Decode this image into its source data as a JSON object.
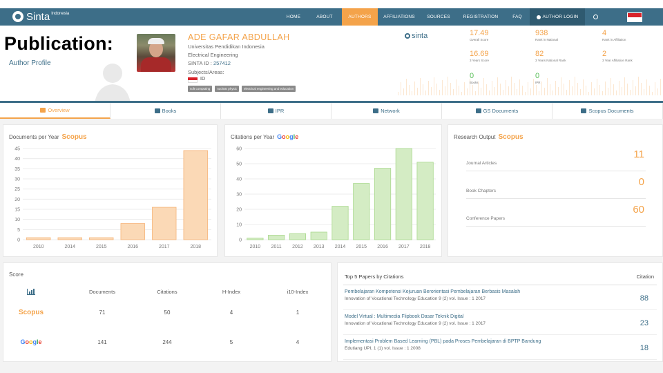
{
  "brand": {
    "name": "Sinta",
    "sub": "Indonesia"
  },
  "nav": {
    "items": [
      "HOME",
      "ABOUT",
      "AUTHORS",
      "AFFILIATIONS",
      "SOURCES",
      "REGISTRATION",
      "FAQ",
      "AUTHOR LOGIN"
    ],
    "active": "AUTHORS",
    "search_icon": "search-icon"
  },
  "page": {
    "title": "Publication:",
    "subtitle": "Author Profile"
  },
  "author": {
    "name": "ADE GAFAR ABDULLAH",
    "university": "Universitas Pendidikan Indonesia",
    "department": "Electrical Engineering",
    "sinta_id_label": "SINTA ID : ",
    "sinta_id": "257412",
    "subjects_label": "Subjects/Areas:",
    "country": "ID",
    "tags": [
      "soft computing",
      "nuclear physic",
      "electrical engineering and education"
    ]
  },
  "sinta_logo": "sinta",
  "scores": [
    {
      "value": "17.49",
      "label": "Overall Score",
      "color": "orange"
    },
    {
      "value": "938",
      "label": "Rank in National",
      "color": "orange"
    },
    {
      "value": "4",
      "label": "Rank in Affiliation",
      "color": "orange"
    },
    {
      "value": "16.69",
      "label": "3 Years Score",
      "color": "orange"
    },
    {
      "value": "82",
      "label": "3 Years National Rank",
      "color": "orange"
    },
    {
      "value": "2",
      "label": "3 Year Affiliation Rank",
      "color": "orange"
    },
    {
      "value": "0",
      "label": "Books",
      "color": "green"
    },
    {
      "value": "0",
      "label": "IPR",
      "color": "green"
    }
  ],
  "tabs": [
    {
      "label": "Overview",
      "icon": "bar-chart-icon"
    },
    {
      "label": "Books",
      "icon": "book-icon"
    },
    {
      "label": "IPR",
      "icon": "copyright-icon"
    },
    {
      "label": "Network",
      "icon": "network-icon"
    },
    {
      "label": "GS Documents",
      "icon": "document-icon"
    },
    {
      "label": "Scopus Documents",
      "icon": "document-icon"
    }
  ],
  "docs_panel": {
    "title": "Documents per Year",
    "brand": "Scopus"
  },
  "cit_panel": {
    "title": "Citations per Year",
    "brand": "Google"
  },
  "ro_panel": {
    "title": "Research Output",
    "brand": "Scopus",
    "rows": [
      {
        "label": "Journal Articles",
        "value": "11"
      },
      {
        "label": "Book Chapters",
        "value": "0"
      },
      {
        "label": "Conference Papers",
        "value": "60"
      }
    ]
  },
  "chart_data": [
    {
      "type": "bar",
      "title": "Documents per Year",
      "categories": [
        "2010",
        "2014",
        "2015",
        "2016",
        "2017",
        "2018"
      ],
      "values": [
        1,
        1,
        1,
        8,
        16,
        44
      ],
      "ylim": [
        0,
        45
      ],
      "yticks": [
        0,
        5,
        10,
        15,
        20,
        25,
        30,
        35,
        40,
        45
      ],
      "yticklabels": [
        "0",
        "5",
        "10",
        "15",
        "20",
        "25",
        "30",
        "35",
        "40",
        "45"
      ],
      "color": "#fbd9b6",
      "grid": true
    },
    {
      "type": "bar",
      "title": "Citations per Year",
      "categories": [
        "2010",
        "2011",
        "2012",
        "2013",
        "2014",
        "2015",
        "2016",
        "2017",
        "2018"
      ],
      "values": [
        1,
        3,
        4,
        5,
        22,
        37,
        47,
        60,
        51
      ],
      "ylim": [
        0,
        60
      ],
      "yticks": [
        0,
        10,
        20,
        30,
        40,
        50,
        60
      ],
      "yticklabels": [
        "0",
        "10",
        "20",
        "30",
        "40",
        "50",
        "60"
      ],
      "color": "#d4ecc4",
      "grid": true
    }
  ],
  "score_panel": {
    "title": "Score",
    "headers": [
      "Documents",
      "Citations",
      "H-Index",
      "i10-Index"
    ],
    "rows": [
      {
        "source": "Scopus",
        "values": [
          "71",
          "50",
          "4",
          "1"
        ]
      },
      {
        "source": "Google",
        "values": [
          "141",
          "244",
          "5",
          "4"
        ]
      }
    ]
  },
  "top5": {
    "title": "Top 5 Papers by Citations",
    "citation_header": "Citation",
    "papers": [
      {
        "title": "Pembelajaran Kompetensi Kejuruan Berorientasi Pembelajaran Berbasis Masalah",
        "journal": "Innovation of Vocational Technology Education 9 (2) vol. Issue : 1 2017",
        "citations": "88"
      },
      {
        "title": "Model Virtual : Multimedia Flipbook Dasar Teknik Digital",
        "journal": "Innovation of Vocational Technology Education 9 (2) vol. Issue : 1 2017",
        "citations": "23"
      },
      {
        "title": "Implementasi Problem Based Learning (PBL) pada Proses Pembelajaran di BPTP Bandung",
        "journal": "Edutiang UPI, 1 (1) vol. Issue : 1 2008",
        "citations": "18"
      }
    ]
  },
  "colors": {
    "nav": "#3d6e88",
    "accent": "#f4a34a",
    "green": "#5bbf5b"
  }
}
